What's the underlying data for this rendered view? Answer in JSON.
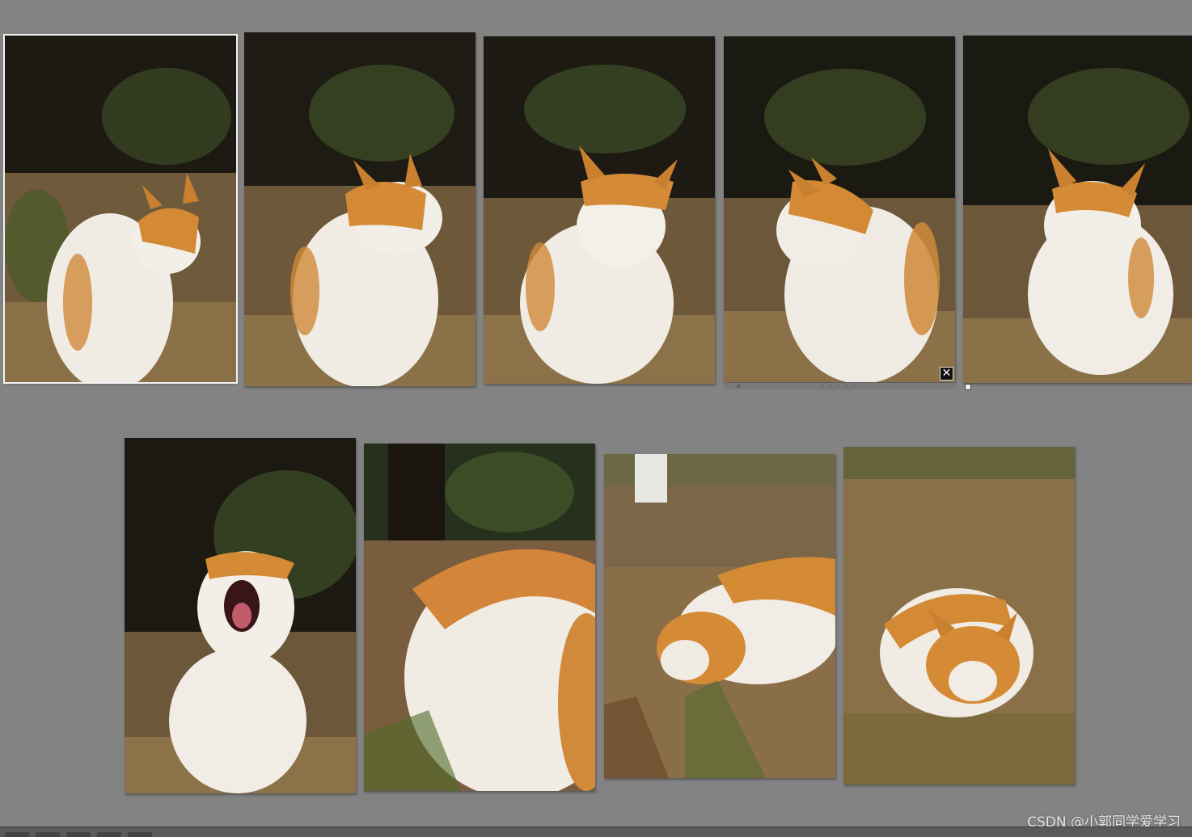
{
  "app": {
    "view": "Grid / Survey view",
    "background_color": "#838383"
  },
  "photos": [
    {
      "name": "cat-photo-1",
      "subject": "cat looking right, eyes closed",
      "selected": true
    },
    {
      "name": "cat-photo-2",
      "subject": "cat squinting, head tilted right",
      "selected": false
    },
    {
      "name": "cat-photo-3",
      "subject": "cat facing camera, eyes closed",
      "selected": false
    },
    {
      "name": "cat-photo-4",
      "subject": "cat looking back over shoulder",
      "selected": false,
      "hover": true
    },
    {
      "name": "cat-photo-5",
      "subject": "cat facing camera, mouth open",
      "selected": false
    },
    {
      "name": "cat-photo-6",
      "subject": "cat yawning",
      "selected": false
    },
    {
      "name": "cat-photo-7",
      "subject": "close-up cat sniffing ground",
      "selected": false
    },
    {
      "name": "cat-photo-8",
      "subject": "cat eating grass on dirt path",
      "selected": false
    },
    {
      "name": "cat-photo-9",
      "subject": "cat crouching in grass",
      "selected": false
    }
  ],
  "hover_controls": {
    "close_label": "✕",
    "bar_label": "✕",
    "bar_dots": "· · · · ·"
  },
  "watermark": "CSDN @小郭同学爱学习"
}
